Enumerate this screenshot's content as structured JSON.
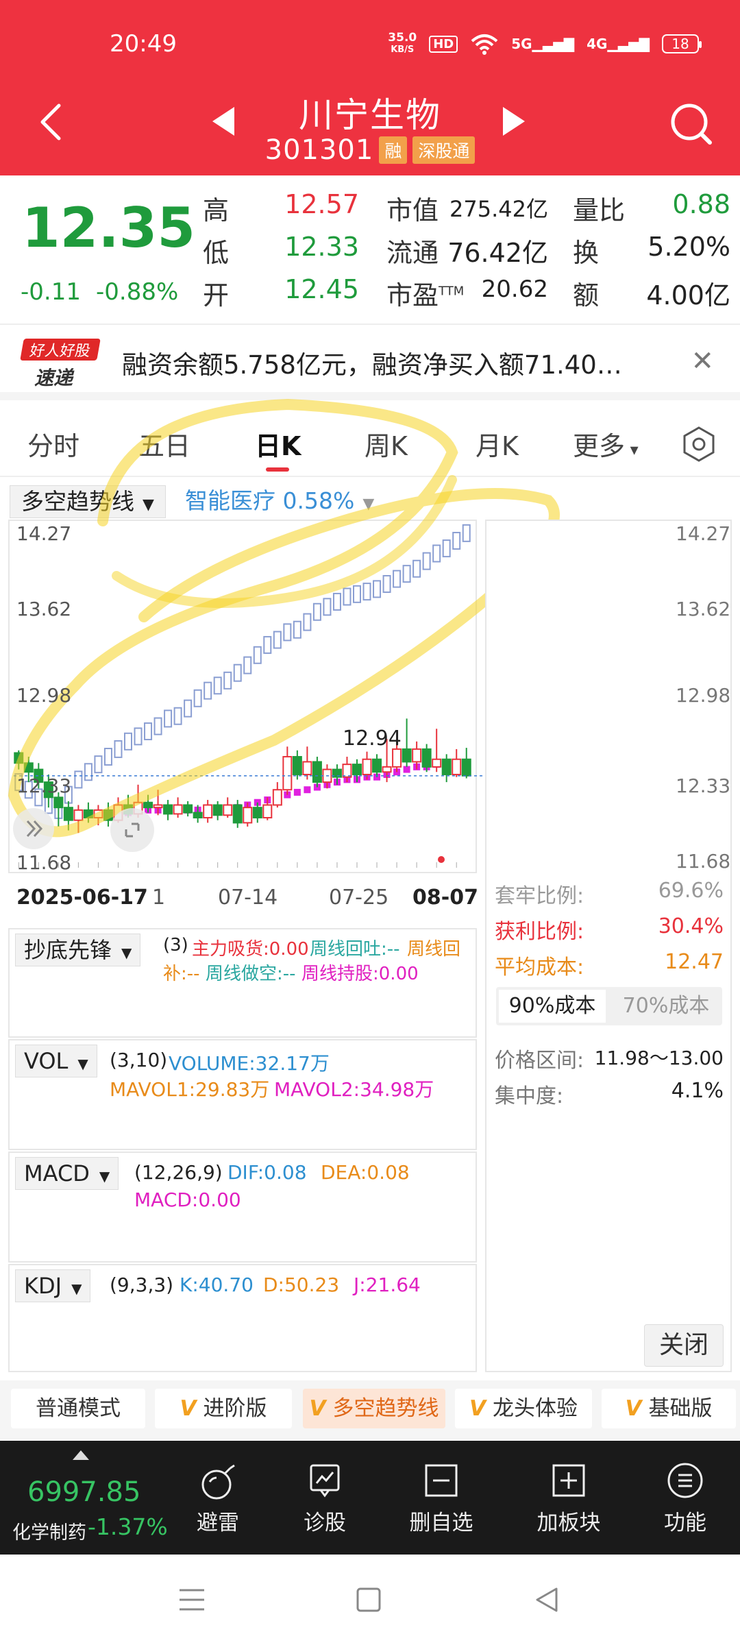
{
  "status_bar": {
    "time": "20:49",
    "speed_value": "35.0",
    "speed_unit": "KB/S",
    "hd": "HD",
    "sig1": "5G",
    "sig2": "4G",
    "battery": "18"
  },
  "header": {
    "name": "川宁生物",
    "code": "301301",
    "tag_margin": "融",
    "tag_connect": "深股通",
    "icons": [
      "back-icon",
      "prev-triangle-icon",
      "next-triangle-icon",
      "search-icon"
    ]
  },
  "quote": {
    "price": "12.35",
    "change": "-0.11",
    "change_pct": "-0.88%",
    "high_label": "高",
    "high": "12.57",
    "low_label": "低",
    "low": "12.33",
    "open_label": "开",
    "open": "12.45",
    "mcap_label": "市值",
    "mcap": "275.42亿",
    "float_label": "流通",
    "float": "76.42亿",
    "pe_label": "市盈",
    "pe_sup": "TTM",
    "pe": "20.62",
    "vr_label": "量比",
    "vr": "0.88",
    "turn_label": "换",
    "turn": "5.20%",
    "amt_label": "额",
    "amt": "4.00亿",
    "colors": {
      "up": "#e8323c",
      "down": "#1f9b3c"
    }
  },
  "banner": {
    "logo_top": "好人好股",
    "logo_bottom": "速递",
    "text": "融资余额5.758亿元，融资净买入额71.40…",
    "close": "✕"
  },
  "tabs": [
    "分时",
    "五日",
    "日K",
    "周K",
    "月K",
    "更多"
  ],
  "tabs_active": "日K",
  "indicator": {
    "main": "多空趋势线",
    "sector": "智能医疗 0.58%"
  },
  "chart_data": {
    "type": "candlestick",
    "y_ticks": [
      "14.27",
      "13.62",
      "12.98",
      "12.33",
      "11.68"
    ],
    "ylim": [
      11.68,
      14.27
    ],
    "x_ticks": [
      "2025-06-17",
      "1",
      "07-14",
      "07-25",
      "08-07"
    ],
    "marker_label": "12.94",
    "candles": [
      {
        "o": 12.53,
        "c": 12.45,
        "h": 12.55,
        "l": 12.4
      },
      {
        "o": 12.45,
        "c": 12.38,
        "h": 12.5,
        "l": 12.3
      },
      {
        "o": 12.4,
        "c": 12.3,
        "h": 12.45,
        "l": 12.25
      },
      {
        "o": 12.3,
        "c": 12.18,
        "h": 12.36,
        "l": 12.1
      },
      {
        "o": 12.18,
        "c": 12.1,
        "h": 12.22,
        "l": 11.95
      },
      {
        "o": 12.1,
        "c": 12.0,
        "h": 12.15,
        "l": 11.92
      },
      {
        "o": 12.0,
        "c": 12.08,
        "h": 12.12,
        "l": 11.9
      },
      {
        "o": 12.08,
        "c": 12.02,
        "h": 12.14,
        "l": 11.98
      },
      {
        "o": 12.02,
        "c": 12.08,
        "h": 12.12,
        "l": 11.96
      },
      {
        "o": 12.08,
        "c": 12.0,
        "h": 12.14,
        "l": 11.95
      },
      {
        "o": 12.0,
        "c": 12.12,
        "h": 12.18,
        "l": 11.98
      },
      {
        "o": 12.12,
        "c": 12.05,
        "h": 12.2,
        "l": 12.02
      },
      {
        "o": 12.05,
        "c": 12.14,
        "h": 12.28,
        "l": 12.02
      },
      {
        "o": 12.14,
        "c": 12.1,
        "h": 12.2,
        "l": 12.06
      },
      {
        "o": 12.1,
        "c": 12.12,
        "h": 12.24,
        "l": 12.04
      },
      {
        "o": 12.12,
        "c": 12.05,
        "h": 12.16,
        "l": 12.0
      },
      {
        "o": 12.05,
        "c": 12.12,
        "h": 12.18,
        "l": 12.02
      },
      {
        "o": 12.12,
        "c": 12.06,
        "h": 12.15,
        "l": 12.03
      },
      {
        "o": 12.06,
        "c": 12.02,
        "h": 12.12,
        "l": 11.98
      },
      {
        "o": 12.02,
        "c": 12.12,
        "h": 12.16,
        "l": 11.98
      },
      {
        "o": 12.12,
        "c": 12.04,
        "h": 12.15,
        "l": 12.0
      },
      {
        "o": 12.04,
        "c": 12.12,
        "h": 12.18,
        "l": 12.02
      },
      {
        "o": 12.12,
        "c": 11.98,
        "h": 12.16,
        "l": 11.94
      },
      {
        "o": 11.98,
        "c": 12.1,
        "h": 12.14,
        "l": 11.95
      },
      {
        "o": 12.1,
        "c": 12.02,
        "h": 12.14,
        "l": 11.98
      },
      {
        "o": 12.02,
        "c": 12.12,
        "h": 12.18,
        "l": 12.0
      },
      {
        "o": 12.12,
        "c": 12.24,
        "h": 12.3,
        "l": 12.1
      },
      {
        "o": 12.24,
        "c": 12.5,
        "h": 12.58,
        "l": 12.2
      },
      {
        "o": 12.5,
        "c": 12.36,
        "h": 12.55,
        "l": 12.32
      },
      {
        "o": 12.36,
        "c": 12.46,
        "h": 12.58,
        "l": 12.32
      },
      {
        "o": 12.46,
        "c": 12.3,
        "h": 12.5,
        "l": 12.26
      },
      {
        "o": 12.3,
        "c": 12.4,
        "h": 12.44,
        "l": 12.25
      },
      {
        "o": 12.4,
        "c": 12.34,
        "h": 12.44,
        "l": 12.28
      },
      {
        "o": 12.34,
        "c": 12.44,
        "h": 12.5,
        "l": 12.3
      },
      {
        "o": 12.44,
        "c": 12.36,
        "h": 12.48,
        "l": 12.3
      },
      {
        "o": 12.36,
        "c": 12.48,
        "h": 12.54,
        "l": 12.32
      },
      {
        "o": 12.48,
        "c": 12.38,
        "h": 12.52,
        "l": 12.34
      },
      {
        "o": 12.38,
        "c": 12.42,
        "h": 12.64,
        "l": 12.3
      },
      {
        "o": 12.42,
        "c": 12.56,
        "h": 12.64,
        "l": 12.38
      },
      {
        "o": 12.56,
        "c": 12.46,
        "h": 12.8,
        "l": 12.42
      },
      {
        "o": 12.46,
        "c": 12.56,
        "h": 12.62,
        "l": 12.4
      },
      {
        "o": 12.56,
        "c": 12.42,
        "h": 12.6,
        "l": 12.38
      },
      {
        "o": 12.42,
        "c": 12.48,
        "h": 12.72,
        "l": 12.38
      },
      {
        "o": 12.48,
        "c": 12.36,
        "h": 12.52,
        "l": 12.3
      },
      {
        "o": 12.36,
        "c": 12.48,
        "h": 12.56,
        "l": 12.34
      },
      {
        "o": 12.48,
        "c": 12.35,
        "h": 12.57,
        "l": 12.33
      }
    ],
    "trend_upper": [
      12.3,
      12.24,
      12.18,
      12.12,
      12.08,
      12.2,
      12.32,
      12.38,
      12.44,
      12.5,
      12.56,
      12.62,
      12.66,
      12.7,
      12.74,
      12.8,
      12.82,
      12.88,
      12.96,
      13.02,
      13.06,
      13.1,
      13.16,
      13.22,
      13.3,
      13.38,
      13.42,
      13.48,
      13.5,
      13.56,
      13.64,
      13.68,
      13.72,
      13.76,
      13.78,
      13.8,
      13.82,
      13.86,
      13.9,
      13.94,
      13.98,
      14.04,
      14.1,
      14.14,
      14.2,
      14.26
    ],
    "trend_lower": [
      12.0,
      12.0,
      12.0,
      12.0,
      12.0,
      12.0,
      12.0,
      12.02,
      12.02,
      12.04,
      12.06,
      12.06,
      12.08,
      12.08,
      12.08,
      12.08,
      12.08,
      12.08,
      12.08,
      12.08,
      12.08,
      12.08,
      12.1,
      12.12,
      12.14,
      12.16,
      12.18,
      12.2,
      12.22,
      12.24,
      12.26,
      12.28,
      12.3,
      12.32,
      12.32,
      12.34,
      12.34,
      12.36,
      12.38,
      12.4,
      12.42,
      12.42,
      12.44,
      12.44,
      12.44,
      12.44
    ],
    "series": [
      {
        "name": "多空趋势线"
      }
    ]
  },
  "chips_profile": {
    "trap_label": "套牢比例:",
    "trap": "69.6%",
    "profit_label": "获利比例:",
    "profit": "30.4%",
    "avg_label": "平均成本:",
    "avg": "12.47",
    "seg_a": "90%成本",
    "seg_b": "70%成本",
    "range_label": "价格区间:",
    "range": "11.98～13.00",
    "conc_label": "集中度:",
    "conc": "4.1%",
    "close": "关闭"
  },
  "sub1": {
    "name": "抄底先锋",
    "params": "(3)",
    "l1": "主力吸货:0.00",
    "l2": "周线回吐:--",
    "l3": "周线回",
    "l4": "补:--",
    "l5": "周线做空:--",
    "l6": "周线持股:0.00"
  },
  "vol": {
    "name": "VOL",
    "params": "(3,10)",
    "volume": "VOLUME:32.17万",
    "ma1": "MAVOL1:29.83万",
    "ma2": "MAVOL2:34.98万"
  },
  "macd": {
    "name": "MACD",
    "params": "(12,26,9)",
    "dif": "DIF:0.08",
    "dea": "DEA:0.08",
    "macd": "MACD:0.00"
  },
  "kdj": {
    "name": "KDJ",
    "params": "(9,3,3)",
    "k": "K:40.70",
    "d": "D:50.23",
    "j": "J:21.64"
  },
  "modes": [
    "普通模式",
    "进阶版",
    "多空趋势线",
    "龙头体验",
    "基础版"
  ],
  "modes_selected": "多空趋势线",
  "toolbar": {
    "index": "6997.85",
    "index_name": "化学制药",
    "index_chg": "-1.37%",
    "buttons": [
      "避雷",
      "诊股",
      "删自选",
      "加板块",
      "功能"
    ]
  }
}
